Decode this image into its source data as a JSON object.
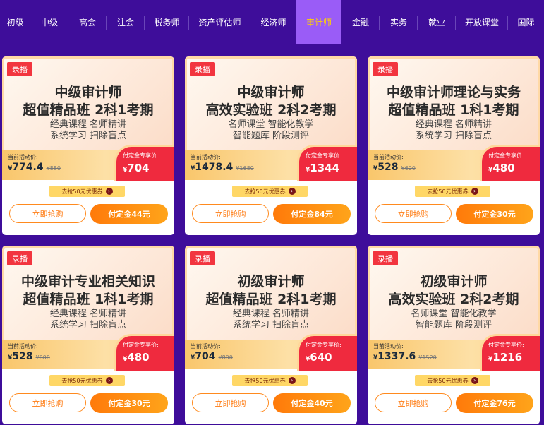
{
  "nav": {
    "items": [
      "初级",
      "中级",
      "高会",
      "注会",
      "税务师",
      "资产评估师",
      "经济师",
      "审计师",
      "金融",
      "实务",
      "就业",
      "开放课堂",
      "国际"
    ],
    "active_index": 7
  },
  "labels": {
    "now": "当前活动价:",
    "deposit": "付定金专享价:",
    "coupon": "去抢50元优惠券",
    "buy": "立即抢购",
    "currency": "¥"
  },
  "colors": {
    "background": "#3e0d9a",
    "active_tab": "#9a5cf7",
    "active_text": "#ffd200",
    "deposit": "#ef2a3e",
    "button": "#ff8a1e"
  },
  "cards": [
    {
      "tag": "录播",
      "title1": "中级审计师",
      "title2": "超值精品班 2科1考期",
      "sub1": "经典课程 名师精讲",
      "sub2": "系统学习 扫除盲点",
      "now": "774.4",
      "old": "¥880",
      "deposit": "704",
      "pay": "付定金44元"
    },
    {
      "tag": "录播",
      "title1": "中级审计师",
      "title2": "高效实验班 2科2考期",
      "sub1": "名师课堂 智能化教学",
      "sub2": "智能题库 阶段测评",
      "now": "1478.4",
      "old": "¥1680",
      "deposit": "1344",
      "pay": "付定金84元"
    },
    {
      "tag": "录播",
      "title1": "中级审计师理论与实务",
      "title2": "超值精品班 1科1考期",
      "sub1": "经典课程 名师精讲",
      "sub2": "系统学习 扫除盲点",
      "now": "528",
      "old": "¥600",
      "deposit": "480",
      "pay": "付定金30元"
    },
    {
      "tag": "录播",
      "title1": "中级审计专业相关知识",
      "title2": "超值精品班 1科1考期",
      "sub1": "经典课程 名师精讲",
      "sub2": "系统学习 扫除盲点",
      "now": "528",
      "old": "¥600",
      "deposit": "480",
      "pay": "付定金30元"
    },
    {
      "tag": "录播",
      "title1": "初级审计师",
      "title2": "超值精品班 2科1考期",
      "sub1": "经典课程 名师精讲",
      "sub2": "系统学习 扫除盲点",
      "now": "704",
      "old": "¥800",
      "deposit": "640",
      "pay": "付定金40元"
    },
    {
      "tag": "录播",
      "title1": "初级审计师",
      "title2": "高效实验班 2科2考期",
      "sub1": "名师课堂 智能化教学",
      "sub2": "智能题库 阶段测评",
      "now": "1337.6",
      "old": "¥1520",
      "deposit": "1216",
      "pay": "付定金76元"
    }
  ]
}
